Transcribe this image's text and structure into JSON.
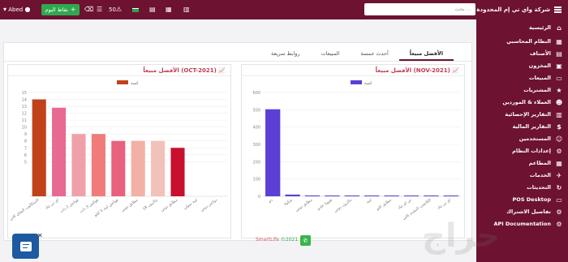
{
  "topbar": {
    "brand": "شركة واي تي إم المحدودة",
    "search_placeholder": "بحث ...",
    "user": "Abed",
    "points_label": "نقاط اليوم",
    "count": "50"
  },
  "sidebar": {
    "items": [
      {
        "label": "الرئيسية",
        "icon": "home-icon",
        "glyph": "⌂"
      },
      {
        "label": "النظام المحاسبي",
        "icon": "accounting-icon",
        "glyph": "▦"
      },
      {
        "label": "الأصناف",
        "icon": "items-icon",
        "glyph": "▤"
      },
      {
        "label": "المخزون",
        "icon": "inventory-icon",
        "glyph": "▣"
      },
      {
        "label": "المبيعات",
        "icon": "sales-icon",
        "glyph": "▭"
      },
      {
        "label": "المشتريات",
        "icon": "purchases-icon",
        "glyph": "★"
      },
      {
        "label": "العملاء & الموردين",
        "icon": "customers-icon",
        "glyph": "☻"
      },
      {
        "label": "التقارير الإحصائية",
        "icon": "stats-icon",
        "glyph": "▥"
      },
      {
        "label": "التقارير المالية",
        "icon": "finance-icon",
        "glyph": "$"
      },
      {
        "label": "المستخدمين",
        "icon": "users-icon",
        "glyph": "☺"
      },
      {
        "label": "إعدادات النظام",
        "icon": "settings-icon",
        "glyph": "⚙"
      },
      {
        "label": "المطاعم",
        "icon": "restaurant-icon",
        "glyph": "▦"
      },
      {
        "label": "الخدمات",
        "icon": "services-icon",
        "glyph": "✈"
      },
      {
        "label": "التحديثات",
        "icon": "updates-icon",
        "glyph": "↻"
      },
      {
        "label": "POS Desktop",
        "icon": "desktop-icon",
        "glyph": "▭"
      },
      {
        "label": "تفاصيل الاشتراك",
        "icon": "subscription-icon",
        "glyph": "⚙"
      },
      {
        "label": "API Documentation",
        "icon": "api-icon",
        "glyph": "⚙"
      }
    ]
  },
  "tabs": [
    {
      "label": "روابط سريعة",
      "active": false
    },
    {
      "label": "المبيعات",
      "active": false
    },
    {
      "label": "أحدث خمسة",
      "active": false
    },
    {
      "label": "الأفضل مبيعاً",
      "active": true
    }
  ],
  "panels": {
    "right_title": "الأفضل مبيعاً (NOV-2021)",
    "left_title": "الأفضل مبيعاً (OCT-2021)"
  },
  "footer": {
    "copyright": "©2021",
    "brand": "SmartLife"
  },
  "chart_data": [
    {
      "type": "bar",
      "legend": "كمية",
      "legend_position": "top",
      "color": "#5b3fd6",
      "categories": [
        "دي",
        "شكولا",
        "مطابق دوس",
        "هيبوتا عادي",
        "ماكرون دوس",
        "لبنة",
        "مطابق كاتو",
        "تي اي تيك",
        "الكاتشب المقدم بالتي",
        "اي تي تيك"
      ],
      "values": [
        503,
        10,
        5,
        3,
        3,
        3,
        2,
        2,
        2,
        1
      ],
      "ylim": [
        0,
        600
      ],
      "yticks": [
        0,
        100,
        200,
        300,
        400,
        500,
        600
      ]
    },
    {
      "type": "bar",
      "legend": "كمية",
      "legend_position": "top",
      "colors": [
        "#c0421a",
        "#e76a93",
        "#f0a0a8",
        "#f07b7b",
        "#e8617e",
        "#f3b0a5",
        "#f2c1ba",
        "#c8102e",
        "#d0d0d0",
        "#d0d0d0"
      ],
      "categories": [
        "الاسكالوب الشاي كاتي",
        "اي تي تيك",
        "هوائش 2 ذات",
        "هوائش 3 ذات",
        "هوائش لبنة 5 كيلو",
        "مطابق دوس",
        "ماكرون 18",
        "مطابق دوس",
        "لبنة سولي",
        "دولاش دوس"
      ],
      "values": [
        14,
        12.8,
        9,
        9,
        8,
        8,
        8,
        7,
        0,
        0
      ],
      "ylim": [
        0,
        15
      ],
      "yticks": [
        5,
        6,
        7,
        8,
        9,
        10,
        11,
        12,
        13,
        14,
        15
      ]
    }
  ]
}
